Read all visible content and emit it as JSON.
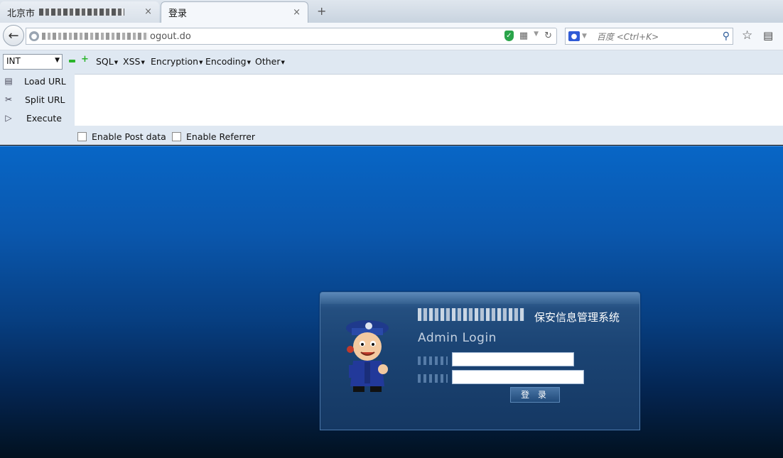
{
  "tabs": [
    {
      "label": "北京市",
      "active": false
    },
    {
      "label": "登录",
      "active": true
    }
  ],
  "tab_close_glyph": "×",
  "new_tab_glyph": "+",
  "address": {
    "url_visible": "ogout.do"
  },
  "search": {
    "placeholder": "百度 <Ctrl+K>"
  },
  "hackbar": {
    "select_value": "INT",
    "menus": [
      "SQL",
      "XSS",
      "Encryption",
      "Encoding",
      "Other"
    ],
    "side": [
      "Load URL",
      "Split URL",
      "Execute"
    ],
    "checks": [
      "Enable Post data",
      "Enable Referrer"
    ]
  },
  "login": {
    "system_title": "保安信息管理系统",
    "subtitle": "Admin Login",
    "button": "登 录"
  },
  "colors": {
    "page_top": "#0866c6",
    "page_bottom": "#02111f",
    "accent_green": "#2bb52b"
  }
}
